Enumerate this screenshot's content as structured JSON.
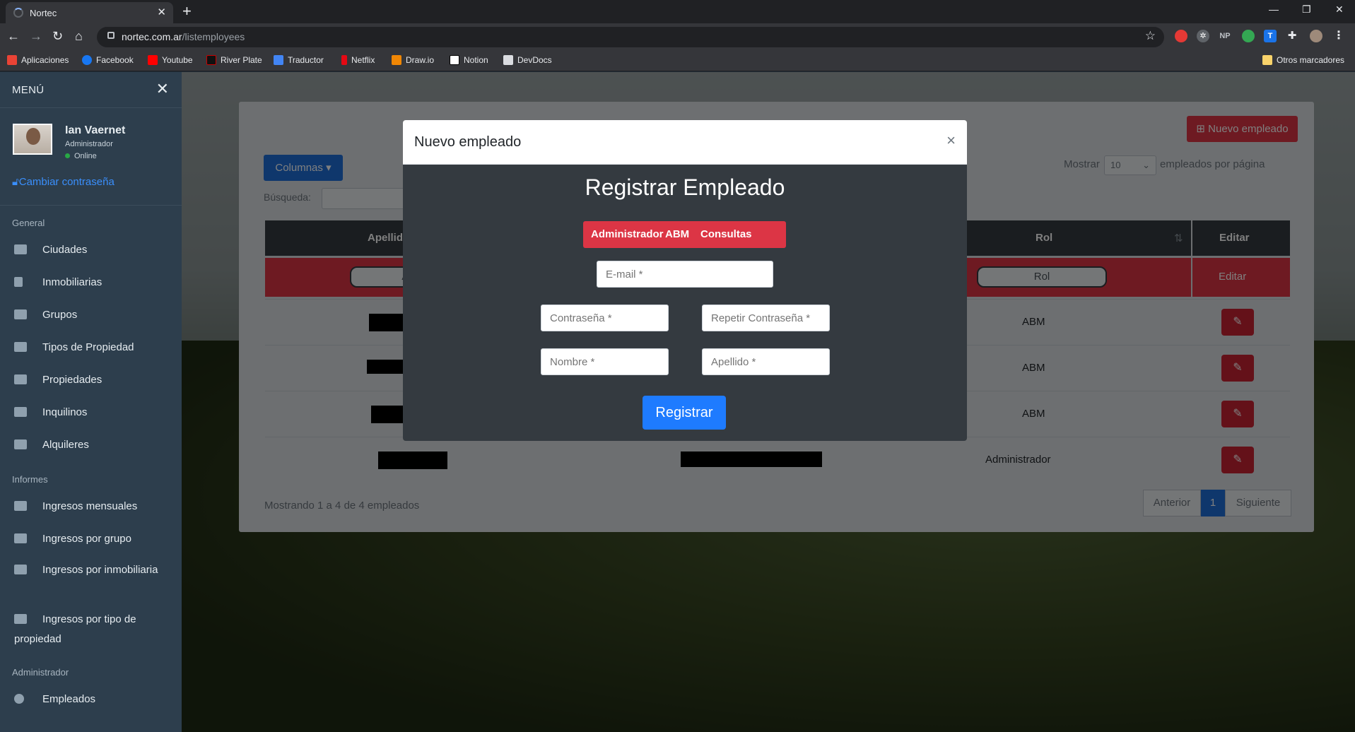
{
  "browser": {
    "tab_title": "Nortec",
    "url_host": "nortec.com.ar",
    "url_path": "/listemployees",
    "bookmarks": [
      "Aplicaciones",
      "Facebook",
      "Youtube",
      "River Plate",
      "Traductor",
      "Netflix",
      "Draw.io",
      "Notion",
      "DevDocs"
    ],
    "other_bookmarks": "Otros marcadores",
    "ext_np": "NP",
    "ext_t": "T"
  },
  "sidebar": {
    "title": "MENÚ",
    "user_name": "Ian Vaernet",
    "user_role": "Administrador",
    "user_status": "Online",
    "change_password": "Cambiar contraseña",
    "section_general": "General",
    "general_items": [
      "Ciudades",
      "Inmobiliarias",
      "Grupos",
      "Tipos de Propiedad",
      "Propiedades",
      "Inquilinos",
      "Alquileres"
    ],
    "section_reports": "Informes",
    "report_items": [
      "Ingresos mensuales",
      "Ingresos por grupo",
      "Ingresos por inmobiliaria",
      "Ingresos por tipo de propiedad"
    ],
    "section_admin": "Administrador",
    "admin_items": [
      "Empleados"
    ]
  },
  "card": {
    "new_button": "Nuevo empleado",
    "columns_button": "Columnas",
    "show_label": "Mostrar",
    "page_size": "10",
    "per_page_label": "empleados por página",
    "search_label": "Búsqueda:",
    "col_apellido": "Apellido",
    "col_rol": "Rol",
    "col_editar": "Editar",
    "filter_apellido": "Apellido",
    "filter_rol": "Rol",
    "filter_editar": "Editar",
    "rows": [
      {
        "rol": "ABM"
      },
      {
        "rol": "ABM"
      },
      {
        "rol": "ABM"
      },
      {
        "rol": "Administrador"
      }
    ],
    "footer": "Mostrando 1 a 4 de 4 empleados",
    "prev": "Anterior",
    "page": "1",
    "next": "Siguiente"
  },
  "modal": {
    "title": "Nuevo empleado",
    "heading": "Registrar Empleado",
    "roles": [
      "Administrador",
      "ABM",
      "Consultas"
    ],
    "email_placeholder": "E-mail *",
    "password_placeholder": "Contraseña *",
    "repeat_placeholder": "Repetir Contraseña *",
    "name_placeholder": "Nombre *",
    "surname_placeholder": "Apellido *",
    "submit": "Registrar"
  }
}
